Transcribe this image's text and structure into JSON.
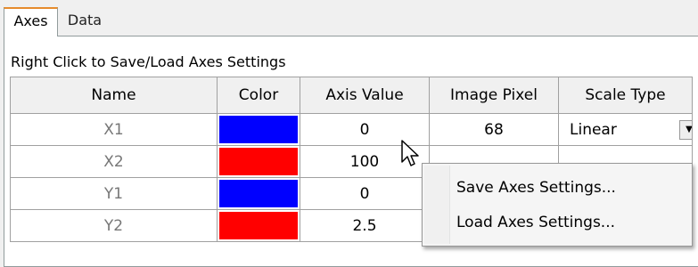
{
  "tabs": [
    {
      "label": "Axes",
      "active": true
    },
    {
      "label": "Data",
      "active": false
    }
  ],
  "hint": "Right Click to Save/Load Axes Settings",
  "grid": {
    "columns": [
      "Name",
      "Color",
      "Axis Value",
      "Image Pixel",
      "Scale Type"
    ],
    "rows": [
      {
        "name": "X1",
        "color": "#0000ff",
        "axis_value": "0",
        "image_pixel": "68",
        "scale_type": "Linear"
      },
      {
        "name": "X2",
        "color": "#ff0000",
        "axis_value": "100",
        "image_pixel": "",
        "scale_type": ""
      },
      {
        "name": "Y1",
        "color": "#0000ff",
        "axis_value": "0",
        "image_pixel": "",
        "scale_type": ""
      },
      {
        "name": "Y2",
        "color": "#ff0000",
        "axis_value": "2.5",
        "image_pixel": "",
        "scale_type": ""
      }
    ]
  },
  "context_menu": {
    "items": [
      "Save Axes Settings...",
      "Load Axes Settings..."
    ]
  },
  "icons": {
    "cursor": "mouse-pointer-icon",
    "dropdown": "chevron-down-icon"
  }
}
